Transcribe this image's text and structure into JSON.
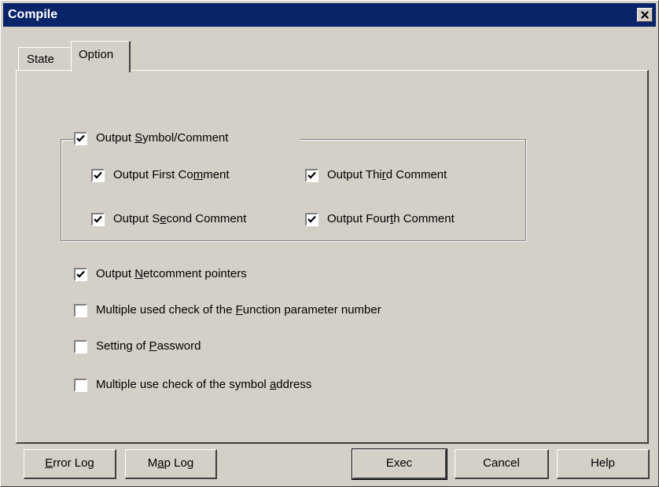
{
  "window": {
    "title": "Compile"
  },
  "tabs": [
    {
      "label": "State",
      "active": false
    },
    {
      "label": "Option",
      "active": true
    }
  ],
  "group": {
    "header": {
      "pre": "Output ",
      "accel": "S",
      "post": "ymbol/Comment",
      "checked": true
    },
    "items": [
      {
        "pre": "Output First Co",
        "accel": "m",
        "post": "ment",
        "checked": true
      },
      {
        "pre": "Output Thi",
        "accel": "r",
        "post": "d Comment",
        "checked": true
      },
      {
        "pre": "Output S",
        "accel": "e",
        "post": "cond Comment",
        "checked": true
      },
      {
        "pre": "Output Four",
        "accel": "t",
        "post": "h Comment",
        "checked": true
      }
    ]
  },
  "options": [
    {
      "pre": "Output ",
      "accel": "N",
      "post": "etcomment pointers",
      "checked": true
    },
    {
      "pre": "Multiple used check of the ",
      "accel": "F",
      "post": "unction parameter number",
      "checked": false
    },
    {
      "pre": "Setting of ",
      "accel": "P",
      "post": "assword",
      "checked": false
    },
    {
      "pre": "Multiple use check of the symbol ",
      "accel": "a",
      "post": "ddress",
      "checked": false
    }
  ],
  "buttons": {
    "error_log": {
      "accel": "E",
      "post": "rror Log"
    },
    "map_log": {
      "pre": "M",
      "accel": "a",
      "post": "p Log"
    },
    "exec": "Exec",
    "cancel": "Cancel",
    "help": "Help"
  }
}
